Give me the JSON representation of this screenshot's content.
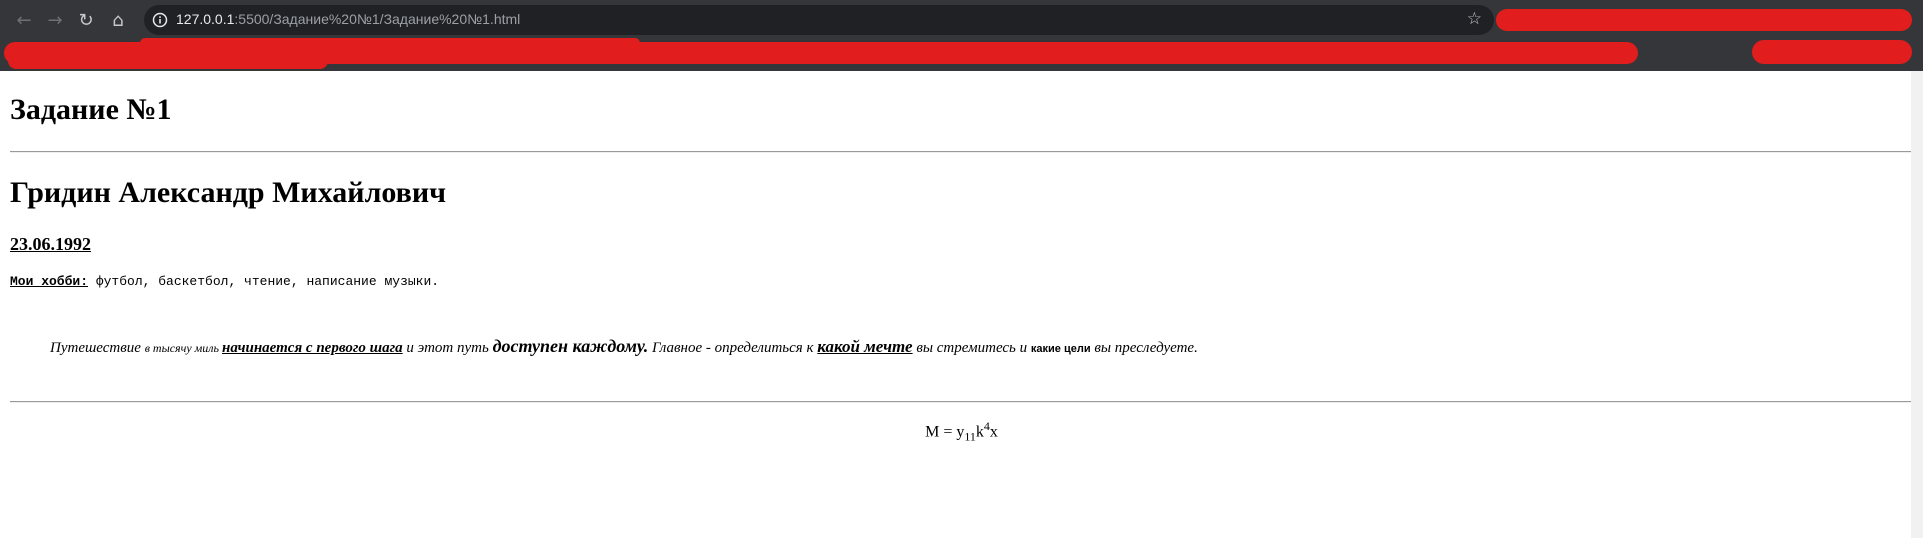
{
  "browser": {
    "url_host": "127.0.0.1",
    "url_path": ":5500/Задание%20№1/Задание%20№1.html",
    "icons": [
      "back-arrow-icon",
      "forward-arrow-icon",
      "reload-icon",
      "home-icon",
      "site-info-icon",
      "bookmark-star-icon"
    ],
    "icon_glyphs": {
      "back": "←",
      "forward": "→",
      "reload": "↻",
      "home": "⌂",
      "star": "☆"
    },
    "redaction_color": "#e11d1d"
  },
  "page": {
    "title": "Задание №1",
    "name": "Гридин Александр Михайлович",
    "date": "23.06.1992",
    "hobbies_label": "Мои хобби:",
    "hobbies_text": " футбол, баскетбол, чтение, написание музыки.",
    "quote": {
      "p1": "Путешествие ",
      "p2": "в тысячу миль ",
      "p3": "начинается с первого шага",
      "p4": " и этот путь ",
      "p5": "доступен каждому.",
      "p6": " Главное - определиться к ",
      "p7": "какой мечте",
      "p8": " вы стремитесь и ",
      "p9": "какие цели",
      "p10": " вы преследуете."
    },
    "formula": {
      "lhs": "M = y",
      "sub": "11",
      "k": "k",
      "sup": "4",
      "x": "x"
    }
  }
}
